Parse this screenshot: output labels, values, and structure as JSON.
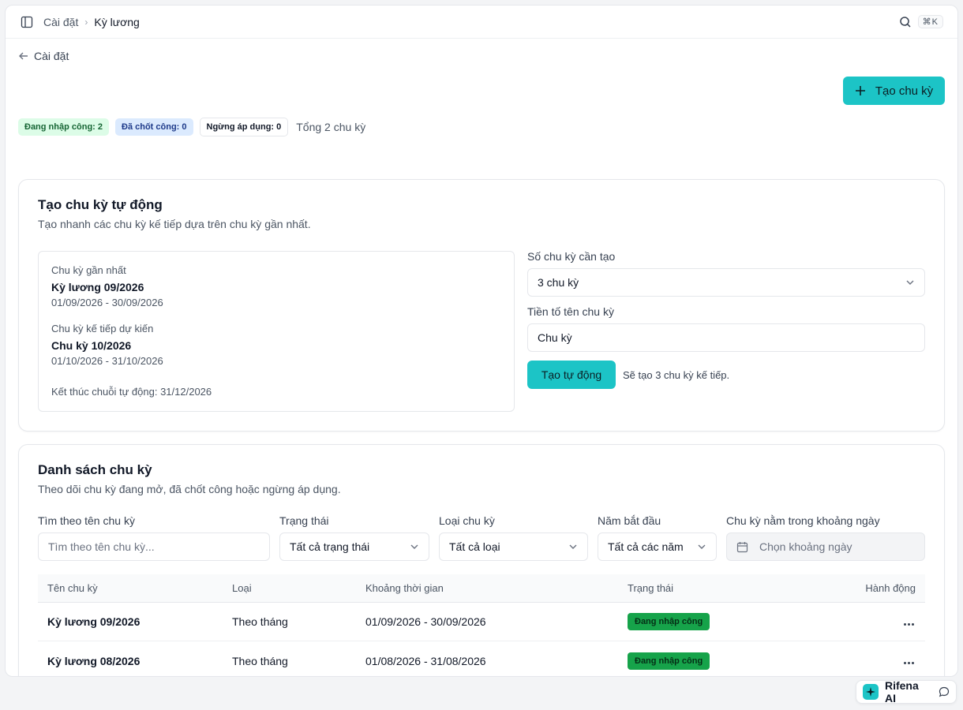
{
  "breadcrumb": {
    "parent": "Cài đặt",
    "current": "Kỳ lương"
  },
  "shortcut": "⌘K",
  "back_label": "Cài đặt",
  "create_button": "Tạo chu kỳ",
  "badges": {
    "entering": "Đang nhập công: 2",
    "locked": "Đã chốt công: 0",
    "stopped": "Ngừng áp dụng: 0",
    "total": "Tổng 2 chu kỳ"
  },
  "auto_card": {
    "title": "Tạo chu kỳ tự động",
    "subtitle": "Tạo nhanh các chu kỳ kế tiếp dựa trên chu kỳ gần nhất.",
    "latest_label": "Chu kỳ gần nhất",
    "latest_name": "Kỳ lương 09/2026",
    "latest_range": "01/09/2026 - 30/09/2026",
    "next_label": "Chu kỳ kế tiếp dự kiến",
    "next_name": "Chu kỳ 10/2026",
    "next_range": "01/10/2026 - 31/10/2026",
    "chain_end": "Kết thúc chuỗi tự động: 31/12/2026",
    "count_label": "Số chu kỳ cần tạo",
    "count_value": "3 chu kỳ",
    "prefix_label": "Tiền tố tên chu kỳ",
    "prefix_value": "Chu kỳ",
    "auto_button": "Tạo tự động",
    "auto_note": "Sẽ tạo 3 chu kỳ kế tiếp."
  },
  "list_card": {
    "title": "Danh sách chu kỳ",
    "subtitle": "Theo dõi chu kỳ đang mở, đã chốt công hoặc ngừng áp dụng.",
    "filters": {
      "search_label": "Tìm theo tên chu kỳ",
      "search_placeholder": "Tìm theo tên chu kỳ...",
      "status_label": "Trạng thái",
      "status_value": "Tất cả trạng thái",
      "type_label": "Loại chu kỳ",
      "type_value": "Tất cả loại",
      "year_label": "Năm bắt đầu",
      "year_value": "Tất cả các năm",
      "range_label": "Chu kỳ nằm trong khoảng ngày",
      "range_placeholder": "Chọn khoảng ngày"
    },
    "columns": [
      "Tên chu kỳ",
      "Loại",
      "Khoảng thời gian",
      "Trạng thái",
      "Hành động"
    ],
    "rows": [
      {
        "name": "Kỳ lương 09/2026",
        "type": "Theo tháng",
        "range": "01/09/2026 - 30/09/2026",
        "status": "Đang nhập công"
      },
      {
        "name": "Kỳ lương 08/2026",
        "type": "Theo tháng",
        "range": "01/08/2026 - 31/08/2026",
        "status": "Đang nhập công"
      }
    ]
  },
  "assistant": {
    "label": "Rifena AI"
  },
  "colors": {
    "accent": "#1cc4c6",
    "status_green": "#16a34a"
  }
}
